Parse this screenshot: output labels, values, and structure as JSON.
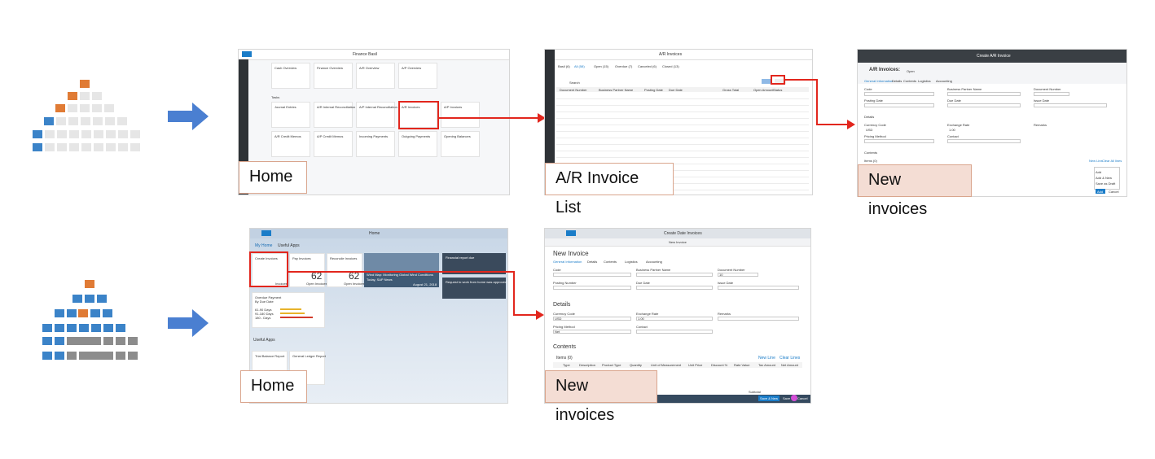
{
  "captions": {
    "row1_home": "Home",
    "row1_list": "A/R Invoice List",
    "row1_new": "New invoices",
    "row2_home": "Home",
    "row2_new": "New invoices"
  },
  "colors": {
    "arrow": "#4a7fd1",
    "pyramid_blue": "#3b83c8",
    "pyramid_orange": "#e07b35",
    "highlight_red": "#e2261d",
    "caption_fill": "#f4ddd4"
  },
  "shot1": {
    "title": "Finance Basil",
    "tiles": [
      "Cash Overview",
      "Finance Overview",
      "A/R Overview",
      "A/P Overview"
    ],
    "section": "Tasks",
    "tasks": [
      "Journal Entries",
      "A/R Internal Reconciliation",
      "A/P Internal Reconciliation",
      "A/R Invoices",
      "A/P Invoices"
    ],
    "tasks2": [
      "A/R Credit Memos",
      "A/P Credit Memos",
      "Incoming Payments",
      "Outgoing Payments",
      "Opening Balances"
    ]
  },
  "shot2": {
    "title": "A/R Invoices",
    "filters": [
      "Basil (6)",
      "All (58)",
      "Open (15)",
      "Overdue (7)",
      "Canceled (6)",
      "Closed (13)"
    ],
    "search": "Search",
    "columns": [
      "Document Number",
      "Business Partner Name",
      "Posting Date",
      "Due Date",
      "Gross Total",
      "Open Amount",
      "Status"
    ]
  },
  "shot3": {
    "title": "Create A/R Invoice",
    "heading": "A/R Invoices:",
    "subheading": "Open",
    "tabs": [
      "General Information",
      "Details",
      "Contents",
      "Logistics",
      "Accounting"
    ],
    "labels": [
      "Code",
      "Business Partner Name",
      "Document Number",
      "Posting Date",
      "Due Date",
      "Issue Date",
      "Details",
      "Currency Code",
      "Exchange Rate",
      "Remarks",
      "Pricing Method",
      "Contact",
      "Contents",
      "Items (0)"
    ],
    "menu": [
      "Add",
      "Add & New",
      "Save as Draft"
    ],
    "buttons": [
      "New Line",
      "Clear All lines",
      "Add",
      "Cancel"
    ],
    "currency": "USD",
    "rate": "1.00"
  },
  "shot4": {
    "title": "Home",
    "tabs": [
      "My Home",
      "Useful Apps"
    ],
    "tiles": [
      {
        "name": "Create Invoices",
        "sub": "Invoices"
      },
      {
        "name": "Pay Invoices",
        "value": "62",
        "sub": "Open Invoices"
      },
      {
        "name": "Reconcile Invoices",
        "value": "62",
        "sub": "Open Invoices"
      }
    ],
    "news_title": "Wind Map: Monitoring Global Wind Conditions",
    "news_sub": "Today, SAP News",
    "news_date": "August 21, 2018",
    "payment_title": "Overdue Payment",
    "payment_sub": "By Due Date",
    "payment_rows": [
      "61-90 Days",
      "91-180 Days",
      "180 - Days"
    ],
    "useful": "Useful Apps",
    "useful_tiles": [
      "Trial Balance Report",
      "General Ledger Report"
    ],
    "notif1": "Financial report due",
    "notif2": "Request to work from home was approved"
  },
  "shot5": {
    "appbar": "Create Date Invoices",
    "subbar": "New Invoice",
    "heading": "New Invoice",
    "tabs": [
      "General Information",
      "Details",
      "Contents",
      "Logistics",
      "Accounting"
    ],
    "labels": [
      "Code",
      "Business Partner Name",
      "Document Number",
      "Posting Number",
      "Due Date",
      "Issue Date",
      "Currency Code",
      "Exchange Rate",
      "Remarks",
      "Pricing Method",
      "Contact"
    ],
    "section_details": "Details",
    "section_contents": "Contents",
    "items": "Items (0)",
    "item_buttons": [
      "New Line",
      "Clear Lines"
    ],
    "columns": [
      "Type",
      "Description",
      "Product Type",
      "Quantity",
      "Unit of Measurement",
      "Unit Price",
      "Discount %",
      "Rate Value",
      "Tax Amount",
      "Net Amount"
    ],
    "currency": "USD",
    "rate": "1.00",
    "doc": "10",
    "pricing": "Net",
    "subtotal": "Subtotal",
    "footer_buttons": [
      "Save & New",
      "Save",
      "Cancel"
    ]
  }
}
